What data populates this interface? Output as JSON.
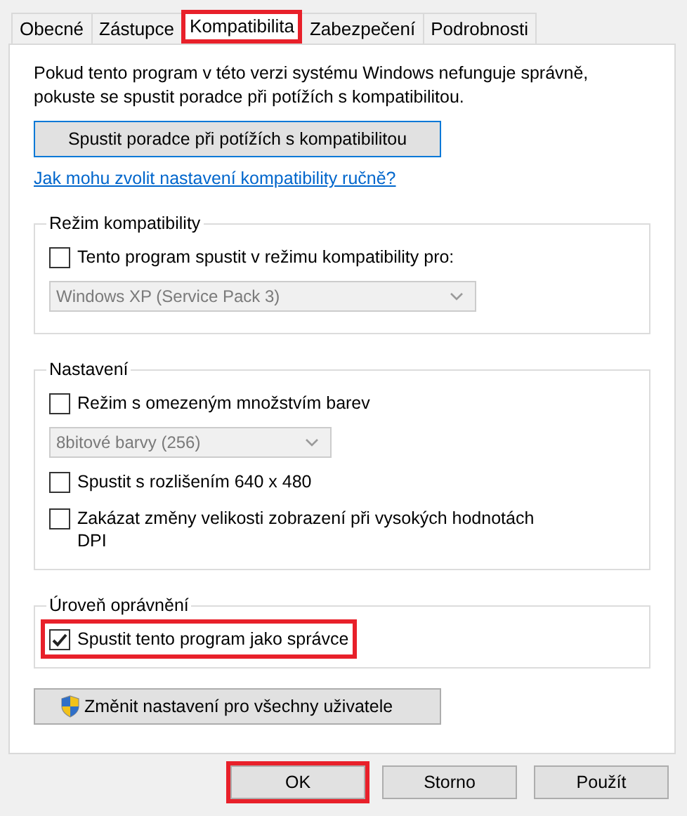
{
  "tabs": [
    {
      "label": "Obecné",
      "selected": false,
      "highlighted": false
    },
    {
      "label": "Zástupce",
      "selected": false,
      "highlighted": false
    },
    {
      "label": "Kompatibilita",
      "selected": true,
      "highlighted": true
    },
    {
      "label": "Zabezpečení",
      "selected": false,
      "highlighted": false
    },
    {
      "label": "Podrobnosti",
      "selected": false,
      "highlighted": false
    }
  ],
  "intro": "Pokud tento program v této verzi systému Windows nefunguje správně, pokuste se spustit poradce při potížích s kompatibilitou.",
  "troubleshoot_button": "Spustit poradce při potížích s kompatibilitou",
  "manual_link": "Jak mohu zvolit nastavení kompatibility ručně?",
  "groups": [
    {
      "title": "Režim kompatibility",
      "items": [
        {
          "kind": "checkbox",
          "label": "Tento program spustit v režimu kompatibility pro:",
          "checked": false,
          "highlighted": false
        },
        {
          "kind": "dropdown",
          "value": "Windows XP (Service Pack 3)",
          "disabled": true,
          "wide": true
        }
      ]
    },
    {
      "title": "Nastavení",
      "items": [
        {
          "kind": "checkbox",
          "label": "Režim s omezeným množstvím barev",
          "checked": false,
          "highlighted": false
        },
        {
          "kind": "dropdown",
          "value": "8bitové barvy (256)",
          "disabled": true,
          "wide": false
        },
        {
          "kind": "checkbox",
          "label": "Spustit s rozlišením 640 x 480",
          "checked": false,
          "highlighted": false
        },
        {
          "kind": "checkbox",
          "label": "Zakázat změny velikosti zobrazení při vysokých hodnotách DPI",
          "checked": false,
          "highlighted": false
        }
      ]
    },
    {
      "title": "Úroveň oprávnění",
      "items": [
        {
          "kind": "checkbox",
          "label": "Spustit tento program jako správce",
          "checked": true,
          "highlighted": true
        }
      ]
    }
  ],
  "all_users_button": "Změnit nastavení pro všechny uživatele",
  "buttons": [
    {
      "label": "OK",
      "highlighted": true
    },
    {
      "label": "Storno",
      "highlighted": false
    },
    {
      "label": "Použít",
      "highlighted": false
    }
  ]
}
